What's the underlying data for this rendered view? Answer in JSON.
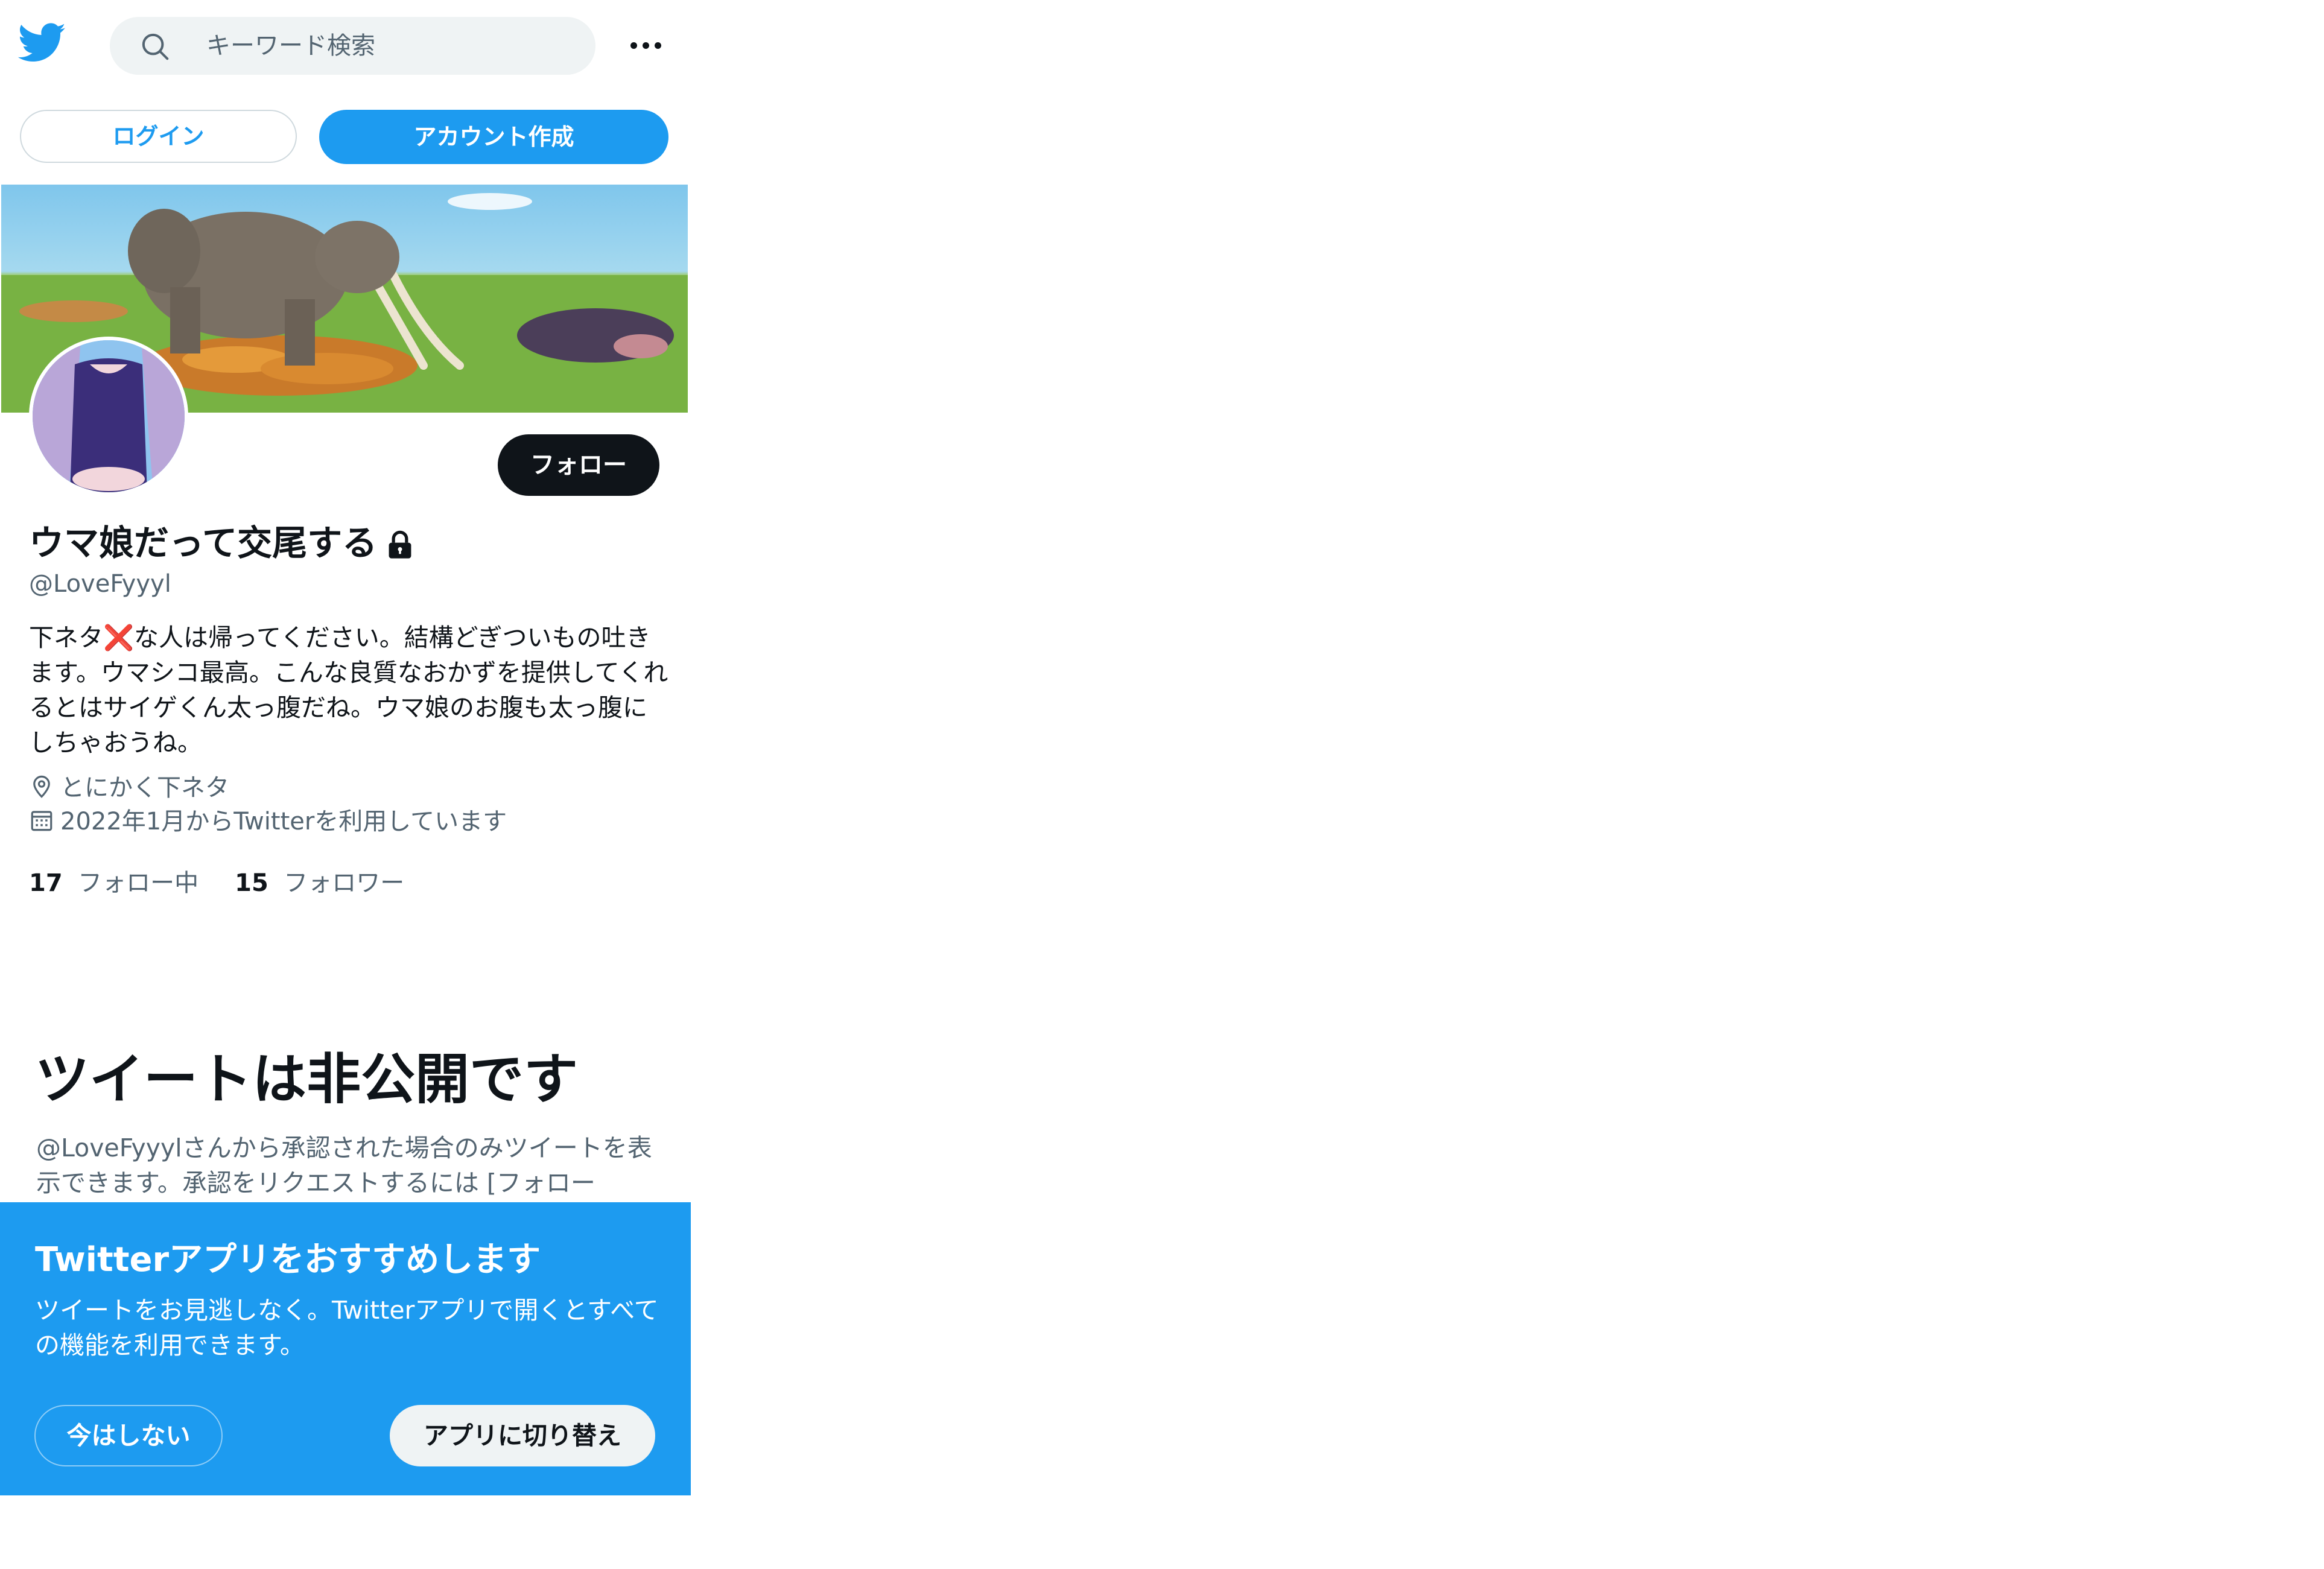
{
  "brand": {
    "accent": "#1d9bf0",
    "dark": "#0f1419",
    "muted": "#536471"
  },
  "header": {
    "search_placeholder": "キーワード検索",
    "logo_icon": "twitter-bird-icon",
    "more_icon": "more-dots-icon"
  },
  "auth": {
    "login_label": "ログイン",
    "signup_label": "アカウント作成"
  },
  "profile": {
    "name": "ウマ娘だって交尾する",
    "handle": "@LoveFyyyl",
    "follow_label": "フォロー",
    "bio": "下ネタ❌な人は帰ってください。結構どぎついもの吐きます。ウマシコ最高。こんな良質なおかずを提供してくれるとはサイゲくん太っ腹だね。ウマ娘のお腹も太っ腹にしちゃおうね。",
    "location": "とにかく下ネタ",
    "joined": "2022年1月からTwitterを利用しています",
    "following_count": "17",
    "following_label": "フォロー中",
    "followers_count": "15",
    "followers_label": "フォロワー"
  },
  "private_notice": {
    "title": "ツイートは非公開です",
    "body": "@LoveFyyylさんから承認された場合のみツイートを表示できます。承認をリクエストするには [フォロー"
  },
  "app_banner": {
    "title": "Twitterアプリをおすすめします",
    "desc": "ツイートをお見逃しなく。Twitterアプリで開くとすべての機能を利用できます。",
    "later_label": "今はしない",
    "switch_label": "アプリに切り替え"
  }
}
